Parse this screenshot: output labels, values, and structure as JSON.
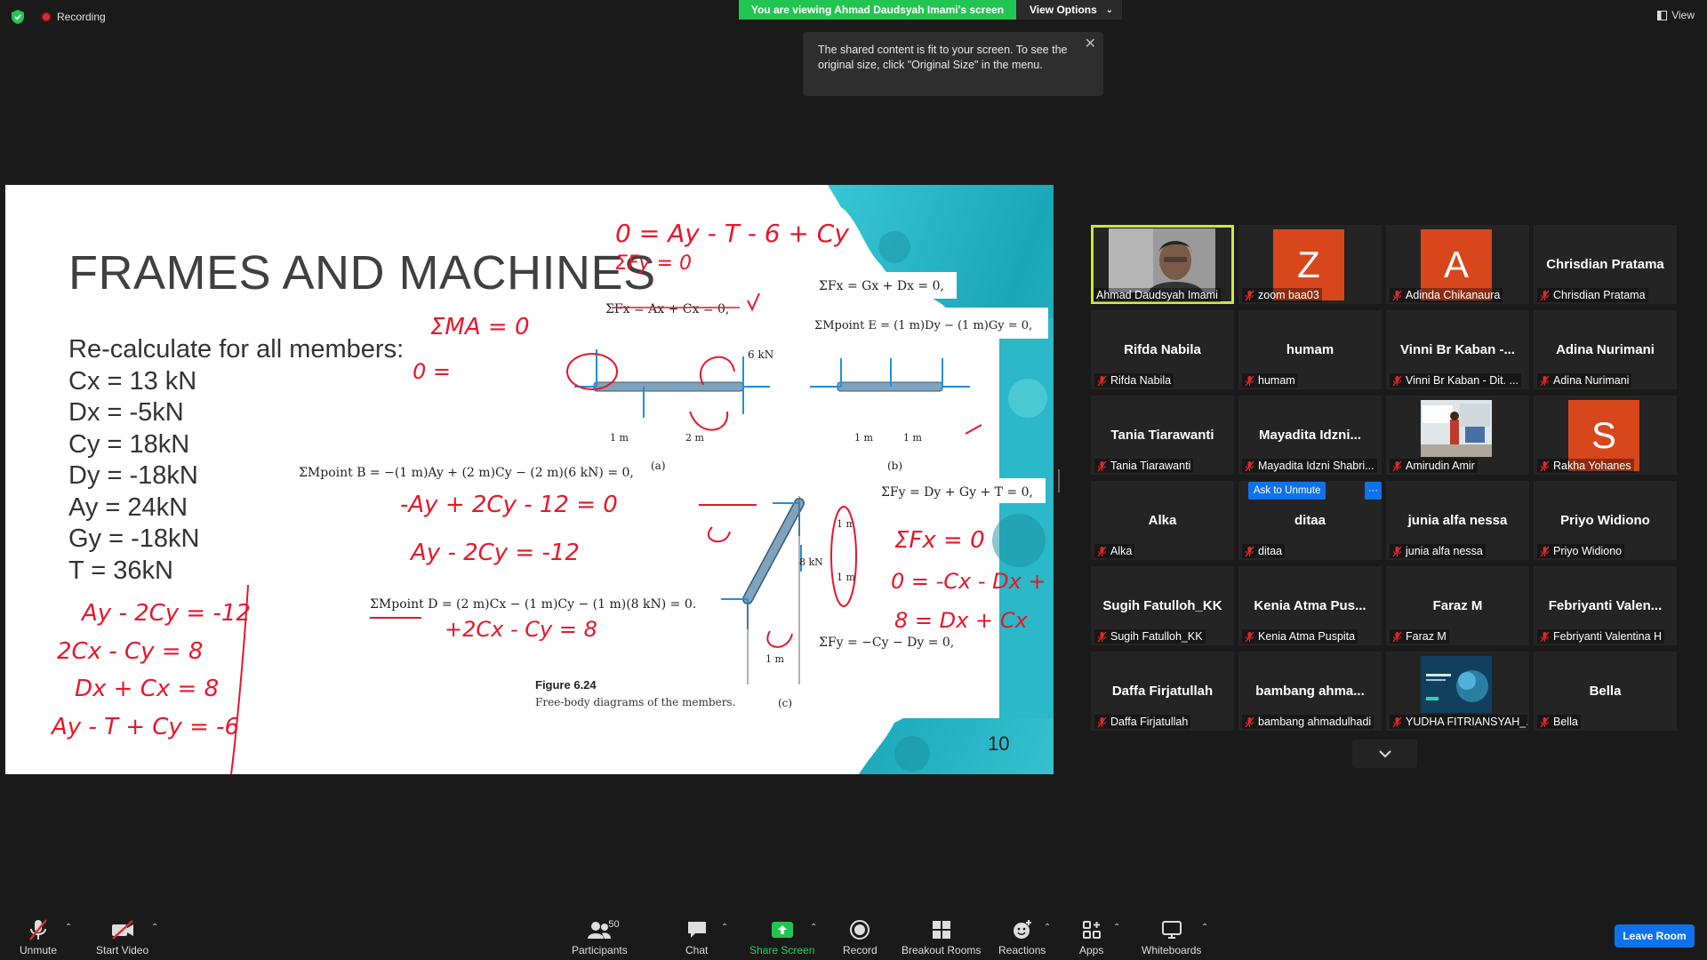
{
  "top": {
    "recording": "Recording",
    "viewing_banner": "You are viewing Ahmad Daudsyah Imami's screen",
    "view_options": "View Options",
    "tooltip": "The shared content is fit to your screen. To see the original size, click \"Original Size\" in the menu.",
    "view_label": "View"
  },
  "slide": {
    "title": "FRAMES AND MACHINES",
    "intro": "Re-calculate for all members:",
    "items": [
      "Cx = 13 kN",
      "Dx = -5kN",
      "Cy = 18kN",
      "Dy = -18kN",
      "Ay = 24kN",
      "Gy = -18kN",
      "T = 36kN"
    ],
    "page_number": "10",
    "figure_caption_title": "Figure 6.24",
    "figure_caption": "Free-body diagrams of the members.",
    "eq_fx_ac": "ΣFx = Ax + Cx = 0,",
    "eq_mb": "ΣMpoint B = −(1 m)Ay + (2 m)Cy − (2 m)(6 kN) = 0,",
    "eq_fx_gd": "ΣFx = Gx + Dx = 0,",
    "eq_me": "ΣMpoint E = (1 m)Dy − (1 m)Gy = 0,",
    "eq_fy_dg": "ΣFy = Dy + Gy + T = 0,",
    "eq_md": "ΣMpoint D = (2 m)Cx − (1 m)Cy − (1 m)(8 kN) = 0.",
    "eq_fy_cd": "ΣFy = −Cy − Dy = 0,",
    "label_a": "(a)",
    "label_b": "(b)",
    "label_c": "(c)",
    "load_6kn": "6 kN",
    "load_8kn": "8 kN",
    "dim_1m": "1 m",
    "dim_2m": "2 m",
    "hand": {
      "h1": "0 = Ay - T - 6 + Cy",
      "h2": "ΣFy = 0",
      "h3": "ΣMA = 0",
      "h4": "0 =",
      "h5": "-Ay + 2Cy - 12 = 0",
      "h6": "Ay - 2Cy = -12",
      "h7": "ΣFx = 0",
      "h8": "0 = -Cx - Dx + 8",
      "h9": "8 = Dx + Cx",
      "h10": "+2Cx - Cy = 8",
      "h11": "Ay - 2Cy = -12",
      "h12": "2Cx - Cy = 8",
      "h13": "Dx + Cx = 8",
      "h14": "Ay - T + Cy = -6"
    }
  },
  "participants": [
    {
      "display": "",
      "name": "Ahmad Daudsyah Imami",
      "type": "video",
      "active": true
    },
    {
      "display": "Z",
      "name": "zoom baa03",
      "type": "letter",
      "color": "#d8461c"
    },
    {
      "display": "A",
      "name": "Adinda Chikanaura",
      "type": "letter",
      "color": "#d8461c"
    },
    {
      "display": "Chrisdian Pratama",
      "name": "Chrisdian Pratama",
      "type": "text"
    },
    {
      "display": "Rifda Nabila",
      "name": "Rifda Nabila",
      "type": "text"
    },
    {
      "display": "humam",
      "name": "humam",
      "type": "text"
    },
    {
      "display": "Vinni Br Kaban -...",
      "name": "Vinni Br Kaban - Dit. ...",
      "type": "text"
    },
    {
      "display": "Adina Nurimani",
      "name": "Adina Nurimani",
      "type": "text"
    },
    {
      "display": "Tania Tiarawanti",
      "name": "Tania Tiarawanti",
      "type": "text"
    },
    {
      "display": "Mayadita Idzni...",
      "name": "Mayadita Idzni Shabri...",
      "type": "text"
    },
    {
      "display": "",
      "name": "Amirudin Amir",
      "type": "photo"
    },
    {
      "display": "S",
      "name": "Rakha Yohanes",
      "type": "letter",
      "color": "#d8461c"
    },
    {
      "display": "Alka",
      "name": "Alka",
      "type": "text"
    },
    {
      "display": "ditaa",
      "name": "ditaa",
      "type": "text",
      "ask_unmute": "Ask to Unmute",
      "more": "···"
    },
    {
      "display": "junia alfa nessa",
      "name": "junia alfa nessa",
      "type": "text"
    },
    {
      "display": "Priyo Widiono",
      "name": "Priyo Widiono",
      "type": "text"
    },
    {
      "display": "Sugih Fatulloh_KK",
      "name": "Sugih Fatulloh_KK",
      "type": "text"
    },
    {
      "display": "Kenia Atma Pus...",
      "name": "Kenia Atma Puspita",
      "type": "text"
    },
    {
      "display": "Faraz M",
      "name": "Faraz M",
      "type": "text"
    },
    {
      "display": "Febriyanti Valen...",
      "name": "Febriyanti Valentina H",
      "type": "text"
    },
    {
      "display": "Daffa Firjatullah",
      "name": "Daffa Firjatullah",
      "type": "text"
    },
    {
      "display": "bambang ahma...",
      "name": "bambang ahmadulhadi",
      "type": "text"
    },
    {
      "display": "",
      "name": "YUDHA FITRIANSYAH_...",
      "type": "screen"
    },
    {
      "display": "Bella",
      "name": "Bella",
      "type": "text"
    }
  ],
  "toolbar": {
    "unmute": "Unmute",
    "start_video": "Start Video",
    "participants": "Participants",
    "participants_count": "50",
    "chat": "Chat",
    "share_screen": "Share Screen",
    "record": "Record",
    "breakout_rooms": "Breakout Rooms",
    "reactions": "Reactions",
    "apps": "Apps",
    "whiteboards": "Whiteboards",
    "leave_room": "Leave Room"
  },
  "colors": {
    "share_green": "#23c552",
    "accent_blue": "#0e72ed",
    "active_speaker": "#cde73a",
    "avatar_orange": "#d8461c",
    "annotation_red": "#e8162a",
    "slide_teal": "#2bb8c8"
  }
}
